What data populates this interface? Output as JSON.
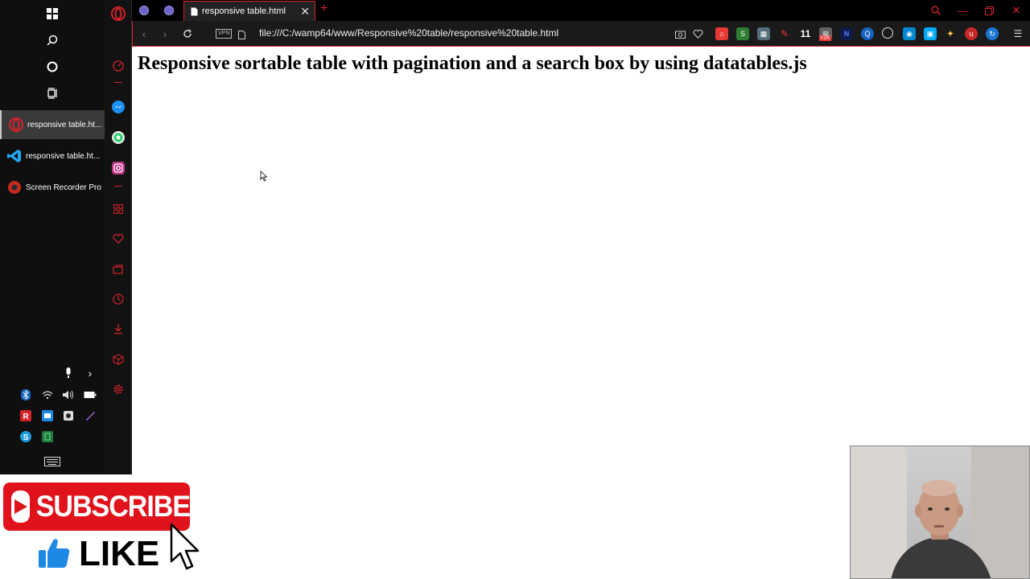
{
  "taskbar": {
    "apps": [
      {
        "label": "responsive table.ht...",
        "icon": "opera-icon",
        "active": true
      },
      {
        "label": "responsive table.ht...",
        "icon": "vscode-icon",
        "active": false
      },
      {
        "label": "Screen Recorder Pro",
        "icon": "screen-recorder-icon",
        "active": false
      }
    ]
  },
  "browser": {
    "tab": {
      "title": "responsive table.html"
    },
    "address": {
      "vpn_label": "VPN",
      "url": "file:///C:/wamp64/www/Responsive%20table/responsive%20table.html"
    },
    "extensions": {
      "badge_count": "11",
      "mail_badge": ">2K"
    }
  },
  "page": {
    "title": "Responsive sortable table with pagination and a search box by using datatables.js"
  },
  "overlay": {
    "subscribe_label": "SUBSCRIBE",
    "like_label": "LIKE"
  },
  "colors": {
    "opera_red": "#d4232b",
    "taskbar_bg": "#0f0f0f",
    "subscribe_red": "#e0121b"
  }
}
